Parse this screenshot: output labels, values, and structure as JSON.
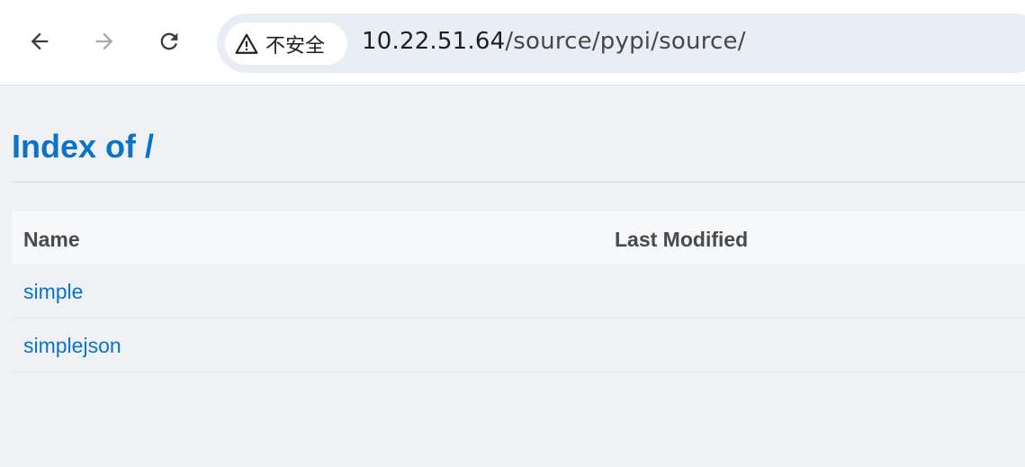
{
  "browser": {
    "security_label": "不安全",
    "url_host": "10.22.51.64",
    "url_path": "/source/pypi/source/",
    "icons": {
      "back": "arrow-left-icon",
      "forward": "arrow-right-icon",
      "reload": "reload-icon",
      "warning": "warning-triangle-icon"
    }
  },
  "page": {
    "title": "Index of /",
    "columns": {
      "name": "Name",
      "last_modified": "Last Modified"
    },
    "entries": [
      {
        "name": "simple",
        "last_modified": ""
      },
      {
        "name": "simplejson",
        "last_modified": ""
      }
    ],
    "colors": {
      "link": "#0b74c8",
      "background": "#eff1f5",
      "header_bg": "#f7f8fa"
    }
  }
}
